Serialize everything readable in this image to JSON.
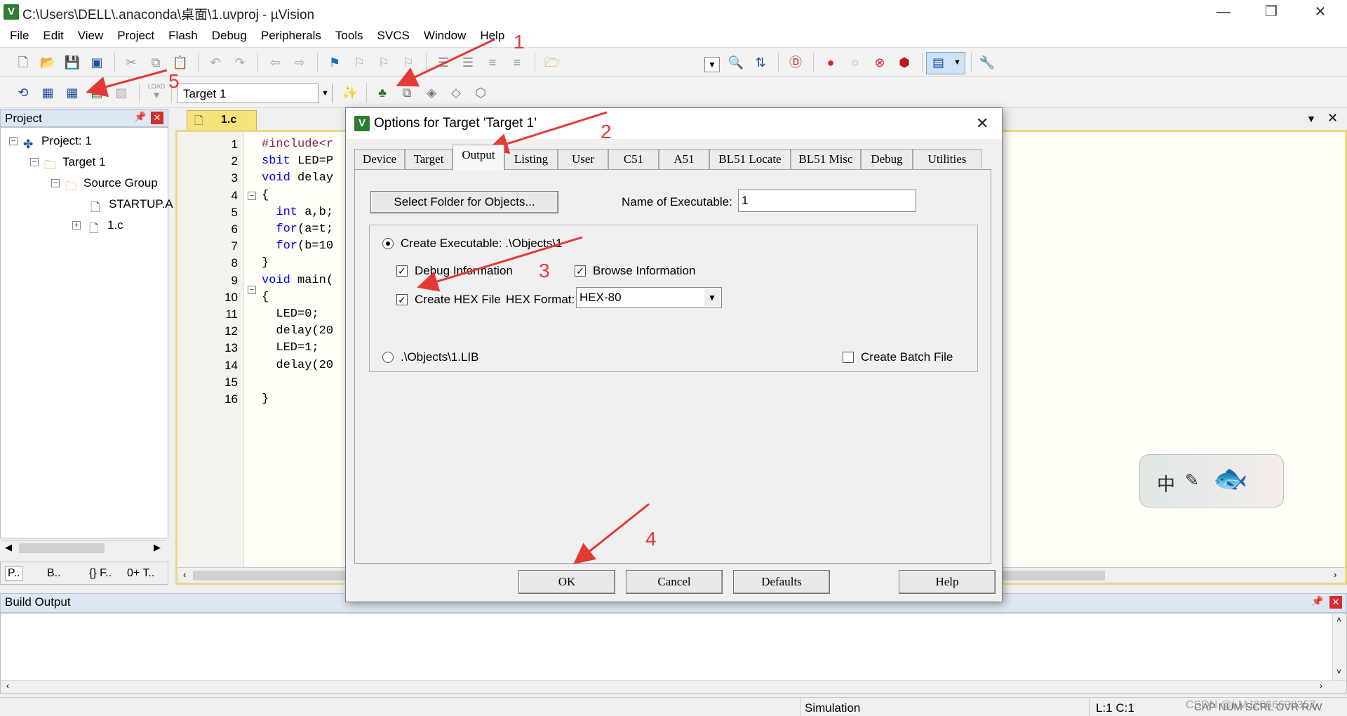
{
  "window": {
    "title": "C:\\Users\\DELL\\.anaconda\\桌面\\1.uvproj - µVision",
    "app_icon": "V"
  },
  "menu": [
    "File",
    "Edit",
    "View",
    "Project",
    "Flash",
    "Debug",
    "Peripherals",
    "Tools",
    "SVCS",
    "Window",
    "Help"
  ],
  "toolbar2": {
    "target_select": "Target 1",
    "load_label": "LOAD"
  },
  "project_panel": {
    "title": "Project",
    "tree": [
      {
        "label": "Project: 1",
        "level": 0,
        "expander": "−"
      },
      {
        "label": "Target 1",
        "level": 1,
        "expander": "−"
      },
      {
        "label": "Source Group",
        "level": 2,
        "expander": "−"
      },
      {
        "label": "STARTUP.A",
        "level": 3,
        "expander": ""
      },
      {
        "label": "1.c",
        "level": 3,
        "expander": "+"
      }
    ],
    "bottom_tabs": [
      "P..",
      "B..",
      "{} F..",
      "0+ T.."
    ]
  },
  "editor": {
    "tab_label": "1.c",
    "lines": [
      {
        "n": "1",
        "text": "#include<r",
        "cls": "pp"
      },
      {
        "n": "2",
        "text": "sbit LED=P",
        "cls": ""
      },
      {
        "n": "3",
        "text": "void delay",
        "cls": ""
      },
      {
        "n": "4",
        "text": "{",
        "cls": ""
      },
      {
        "n": "5",
        "text": "  int a,b;",
        "cls": ""
      },
      {
        "n": "6",
        "text": "  for(a=t;",
        "cls": ""
      },
      {
        "n": "7",
        "text": "  for(b=10",
        "cls": ""
      },
      {
        "n": "8",
        "text": "}",
        "cls": ""
      },
      {
        "n": "9",
        "text": "void main(",
        "cls": ""
      },
      {
        "n": "10",
        "text": "{",
        "cls": ""
      },
      {
        "n": "11",
        "text": "  LED=0;",
        "cls": ""
      },
      {
        "n": "12",
        "text": "  delay(20",
        "cls": ""
      },
      {
        "n": "13",
        "text": "  LED=1;",
        "cls": ""
      },
      {
        "n": "14",
        "text": "  delay(20",
        "cls": ""
      },
      {
        "n": "15",
        "text": "",
        "cls": ""
      },
      {
        "n": "16",
        "text": "}",
        "cls": ""
      }
    ]
  },
  "dialog": {
    "title": "Options for Target 'Target 1'",
    "tabs": [
      "Device",
      "Target",
      "Output",
      "Listing",
      "User",
      "C51",
      "A51",
      "BL51 Locate",
      "BL51 Misc",
      "Debug",
      "Utilities"
    ],
    "active_tab": "Output",
    "select_folder_button": "Select Folder for Objects...",
    "name_exe_label": "Name of Executable:",
    "name_exe_value": "1",
    "create_exe_label": "Create Executable:  .\\Objects\\1",
    "debug_info_label": "Debug Information",
    "browse_info_label": "Browse Information",
    "create_hex_label": "Create HEX File",
    "hex_format_label": "HEX Format:",
    "hex_format_value": "HEX-80",
    "lib_label": ".\\Objects\\1.LIB",
    "batch_label": "Create Batch File",
    "buttons": {
      "ok": "OK",
      "cancel": "Cancel",
      "defaults": "Defaults",
      "help": "Help"
    }
  },
  "build_output": {
    "title": "Build Output"
  },
  "status": {
    "mode": "Simulation",
    "position": "L:1 C:1",
    "flags": "CAP  NUM  SCRL  OVR  R/W",
    "watermark": "CSDN @LMJ2066638357"
  },
  "ime": {
    "char": "中"
  },
  "annotations": [
    "1",
    "2",
    "3",
    "4",
    "5"
  ]
}
